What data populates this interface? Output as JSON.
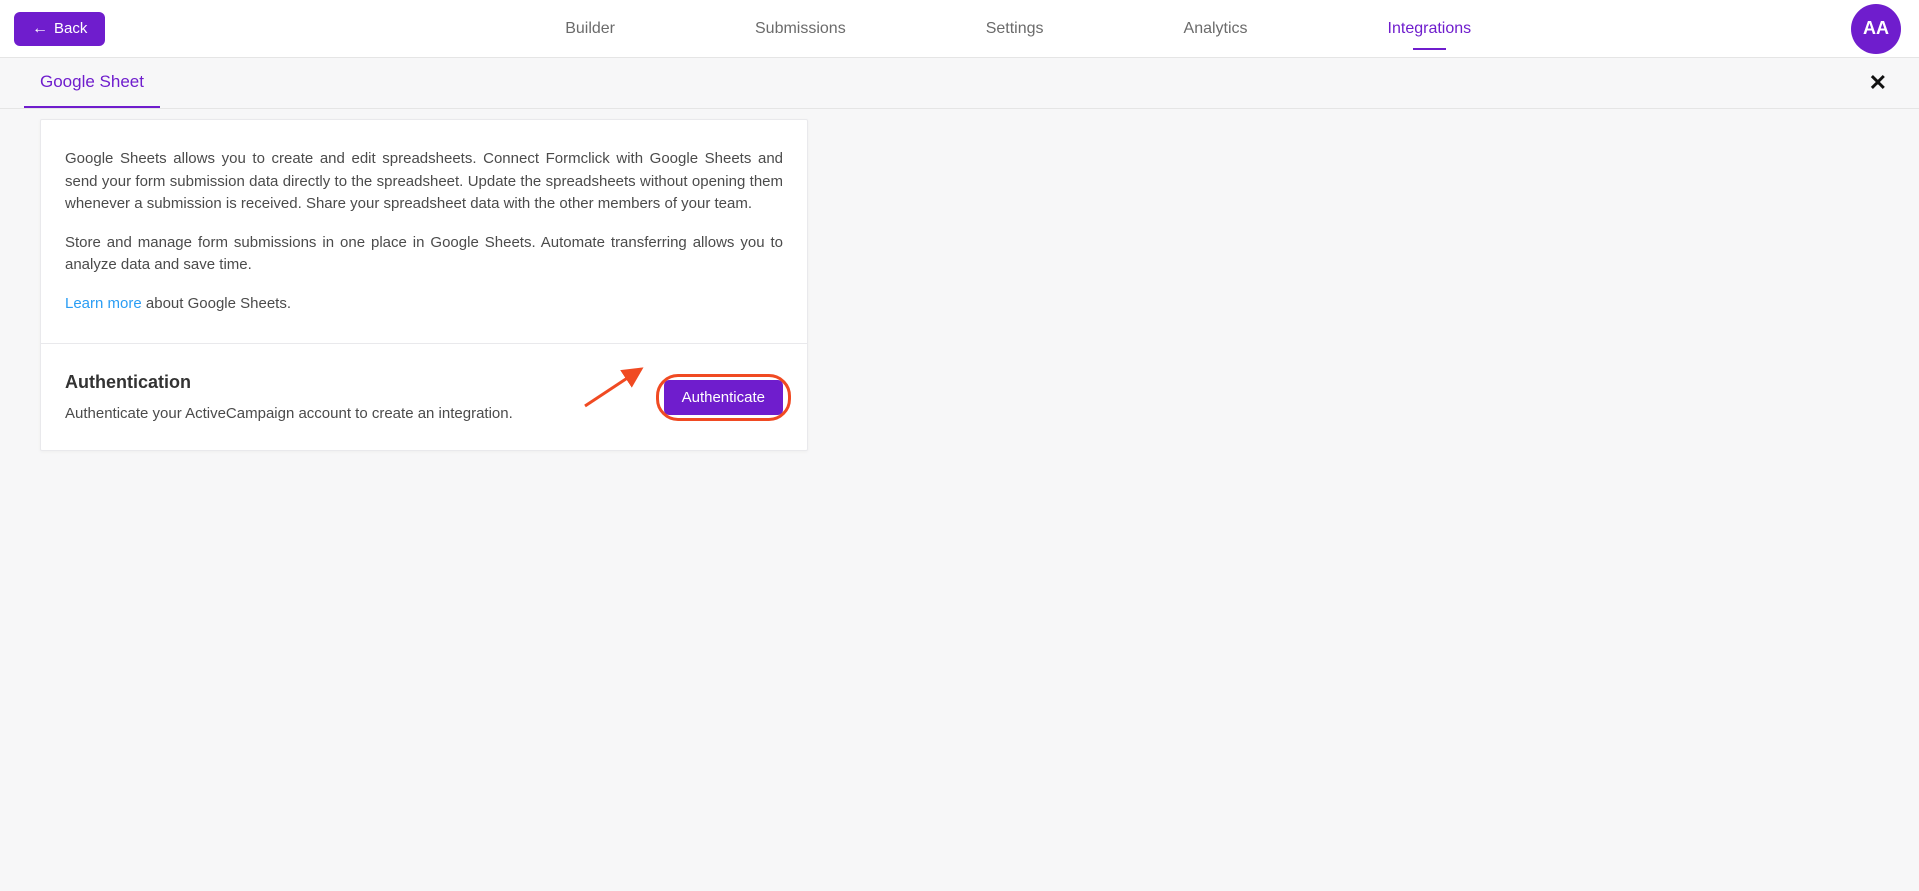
{
  "header": {
    "back_label": "Back",
    "tabs": [
      {
        "label": "Builder",
        "active": false
      },
      {
        "label": "Submissions",
        "active": false
      },
      {
        "label": "Settings",
        "active": false
      },
      {
        "label": "Analytics",
        "active": false
      },
      {
        "label": "Integrations",
        "active": true
      }
    ],
    "avatar_initials": "AA"
  },
  "subtab": {
    "label": "Google Sheet"
  },
  "card": {
    "description1": "Google Sheets allows you to create and edit spreadsheets. Connect Formclick with Google Sheets and send your form submission data directly to the spreadsheet. Update the spreadsheets without opening them whenever a submission is received. Share your spreadsheet data with the other members of your team.",
    "description2": "Store and manage form submissions in one place in Google Sheets. Automate transferring allows you to analyze data and save time.",
    "learn_more": "Learn more",
    "learn_more_suffix": " about Google Sheets.",
    "auth_heading": "Authentication",
    "auth_text": "Authenticate your ActiveCampaign account to create an integration.",
    "auth_button": "Authenticate"
  }
}
